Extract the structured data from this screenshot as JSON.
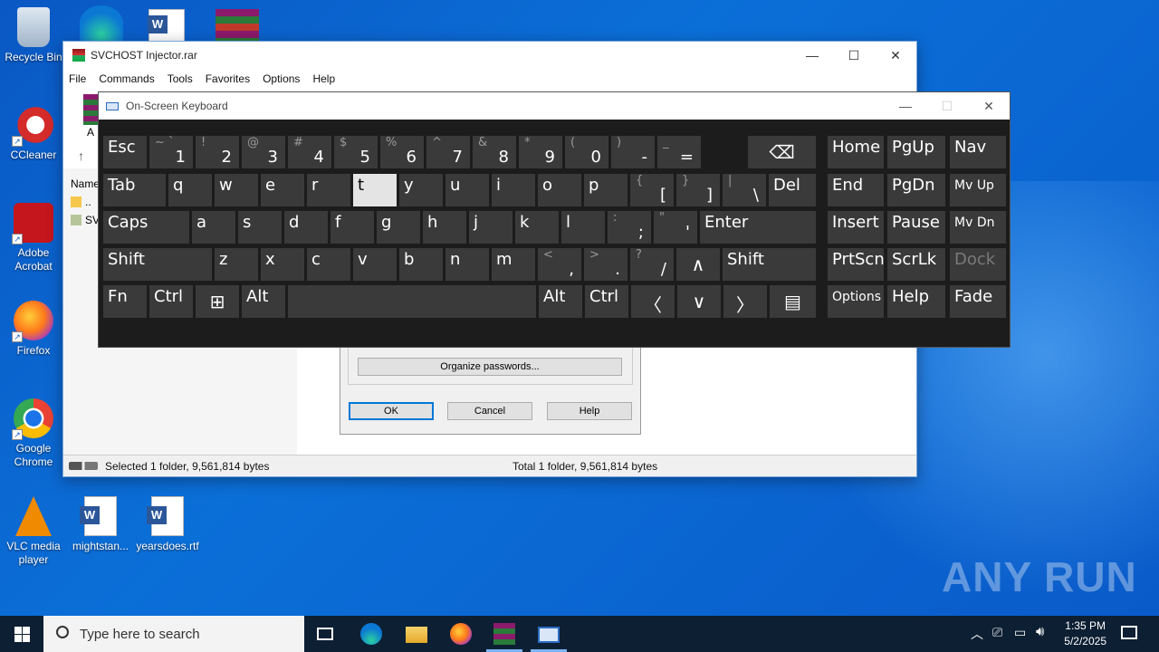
{
  "desktop": {
    "icons": [
      {
        "label": "Recycle Bin"
      },
      {
        "label": "CCleaner"
      },
      {
        "label": "Adobe Acrobat"
      },
      {
        "label": "Firefox"
      },
      {
        "label": "Google Chrome"
      },
      {
        "label": "VLC media player"
      },
      {
        "label": "mightstan..."
      },
      {
        "label": "yearsdoes.rtf"
      }
    ],
    "watermark": "ANY RUN"
  },
  "winrar": {
    "title": "SVCHOST Injector.rar",
    "menu": [
      "File",
      "Commands",
      "Tools",
      "Favorites",
      "Options",
      "Help"
    ],
    "toolbar_partial": "A",
    "list_header": "Name",
    "list_items": [
      "..",
      "SV"
    ],
    "status_left": "Selected 1 folder, 9,561,814 bytes",
    "status_right": "Total 1 folder, 9,561,814 bytes"
  },
  "dialog": {
    "organize_label": "Organize passwords...",
    "ok_label": "OK",
    "cancel_label": "Cancel",
    "help_label": "Help"
  },
  "osk": {
    "title": "On-Screen Keyboard",
    "rows": {
      "r1": [
        "Esc",
        "1",
        "2",
        "3",
        "4",
        "5",
        "6",
        "7",
        "8",
        "9",
        "0",
        "-",
        "="
      ],
      "r1_shift": [
        "~ `",
        "!",
        "@",
        "#",
        "$",
        "%",
        "^",
        "&",
        "*",
        "(",
        ")",
        "_",
        "+"
      ],
      "r2": [
        "Tab",
        "q",
        "w",
        "e",
        "r",
        "t",
        "y",
        "u",
        "i",
        "o",
        "p",
        "[",
        "]",
        "\\",
        "Del"
      ],
      "r2_shift": [
        "{",
        "}",
        "|"
      ],
      "r3": [
        "Caps",
        "a",
        "s",
        "d",
        "f",
        "g",
        "h",
        "j",
        "k",
        "l",
        ";",
        "'",
        "Enter"
      ],
      "r3_shift": [
        ":",
        "\""
      ],
      "r4": [
        "Shift",
        "z",
        "x",
        "c",
        "v",
        "b",
        "n",
        "m",
        ",",
        ".",
        "/",
        "Shift"
      ],
      "r4_shift": [
        "<",
        ">",
        "?"
      ],
      "r5": [
        "Fn",
        "Ctrl",
        "Alt",
        "Alt",
        "Ctrl"
      ],
      "nav": [
        "Home",
        "PgUp",
        "Nav",
        "End",
        "PgDn",
        "Mv Up",
        "Insert",
        "Pause",
        "Mv Dn",
        "PrtScn",
        "ScrLk",
        "Dock",
        "Options",
        "Help",
        "Fade"
      ]
    },
    "pressed_key": "t"
  },
  "taskbar": {
    "search_placeholder": "Type here to search",
    "time": "1:35 PM",
    "date": "5/2/2025"
  }
}
